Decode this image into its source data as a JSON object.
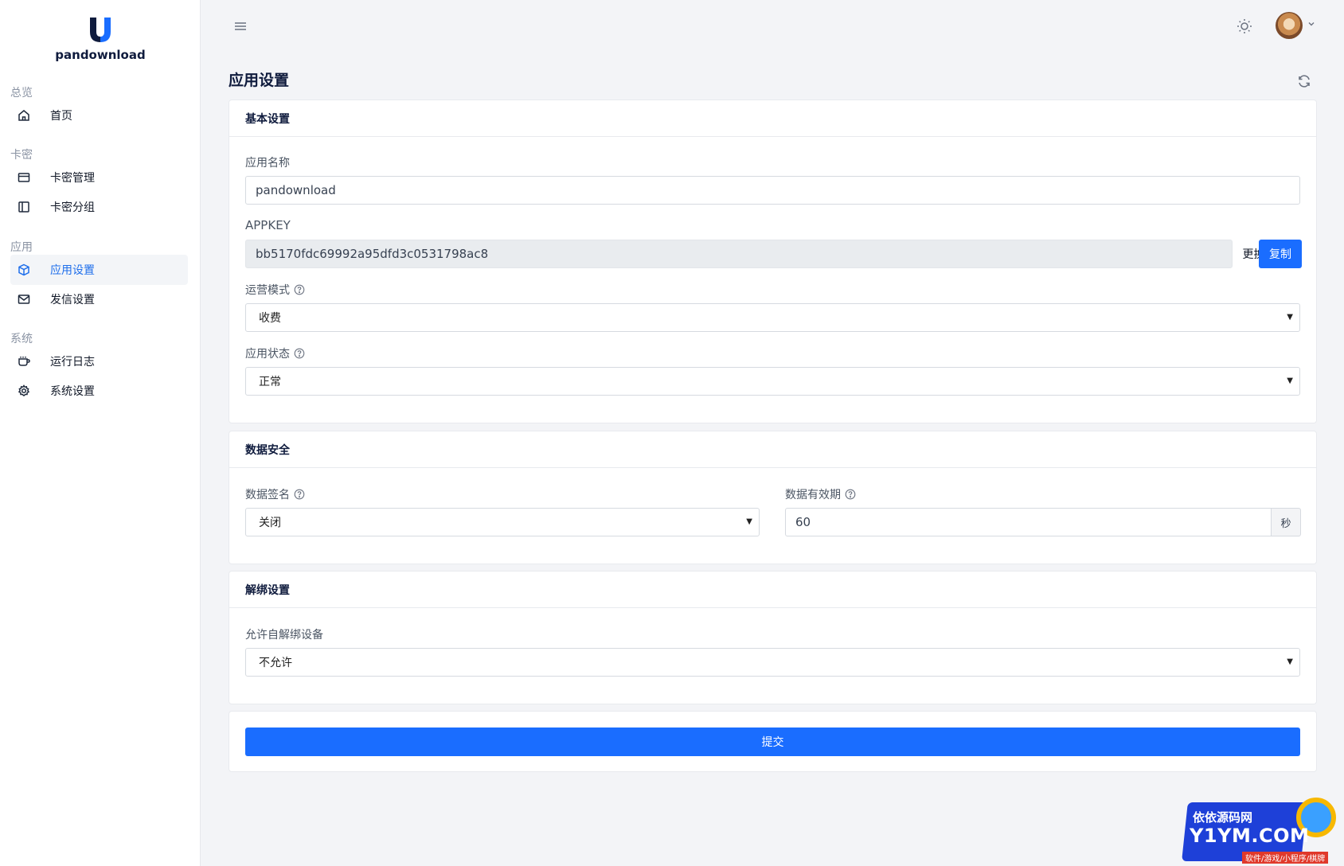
{
  "app": {
    "brand_name": "pandownload"
  },
  "sidebar": {
    "sections": [
      {
        "title": "总览",
        "items": [
          {
            "label": "首页",
            "icon": "home-icon",
            "active": false
          }
        ]
      },
      {
        "title": "卡密",
        "items": [
          {
            "label": "卡密管理",
            "icon": "card-icon",
            "active": false
          },
          {
            "label": "卡密分组",
            "icon": "group-icon",
            "active": false
          }
        ]
      },
      {
        "title": "应用",
        "items": [
          {
            "label": "应用设置",
            "icon": "cube-icon",
            "active": true
          },
          {
            "label": "发信设置",
            "icon": "mail-icon",
            "active": false
          }
        ]
      },
      {
        "title": "系统",
        "items": [
          {
            "label": "运行日志",
            "icon": "cup-icon",
            "active": false
          },
          {
            "label": "系统设置",
            "icon": "gear-icon",
            "active": false
          }
        ]
      }
    ]
  },
  "page": {
    "title": "应用设置"
  },
  "basic": {
    "title": "基本设置",
    "app_name_label": "应用名称",
    "app_name_value": "pandownload",
    "appkey_label": "APPKEY",
    "appkey_value": "bb5170fdc69992a95dfd3c0531798ac8",
    "replace_label": "更换",
    "copy_label": "复制",
    "mode_label": "运营模式",
    "mode_value": "收费",
    "status_label": "应用状态",
    "status_value": "正常"
  },
  "security": {
    "title": "数据安全",
    "sign_label": "数据签名",
    "sign_value": "关闭",
    "expiry_label": "数据有效期",
    "expiry_value": "60",
    "expiry_unit": "秒"
  },
  "unbind": {
    "title": "解绑设置",
    "allow_label": "允许自解绑设备",
    "allow_value": "不允许"
  },
  "submit_label": "提交",
  "watermark": {
    "line1": "依依源码网",
    "line2": "Y1YM.COM",
    "line3": "软件/游戏/小程序/棋牌"
  },
  "colors": {
    "primary": "#1a6dff",
    "active_text": "#1f6feb"
  }
}
